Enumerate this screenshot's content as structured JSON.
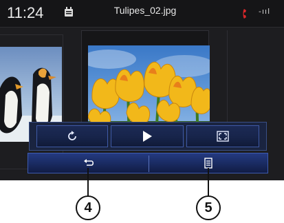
{
  "status_bar": {
    "time": "11:24",
    "file_name": "Tulipes_02.jpg",
    "signal_text": "-ııl",
    "icons": [
      "media-player-icon",
      "phone-icon",
      "signal-strength-icon"
    ]
  },
  "controls": {
    "rotate": "rotate-icon",
    "play": "play-icon",
    "fullscreen": "fullscreen-icon",
    "back": "back-icon",
    "menu": "menu-icon"
  },
  "callouts": {
    "back_number": "4",
    "menu_number": "5"
  },
  "colors": {
    "accent_blue": "#2b4a9c",
    "phone_red": "#d8262a",
    "screen_bg": "#1a1a1c"
  }
}
